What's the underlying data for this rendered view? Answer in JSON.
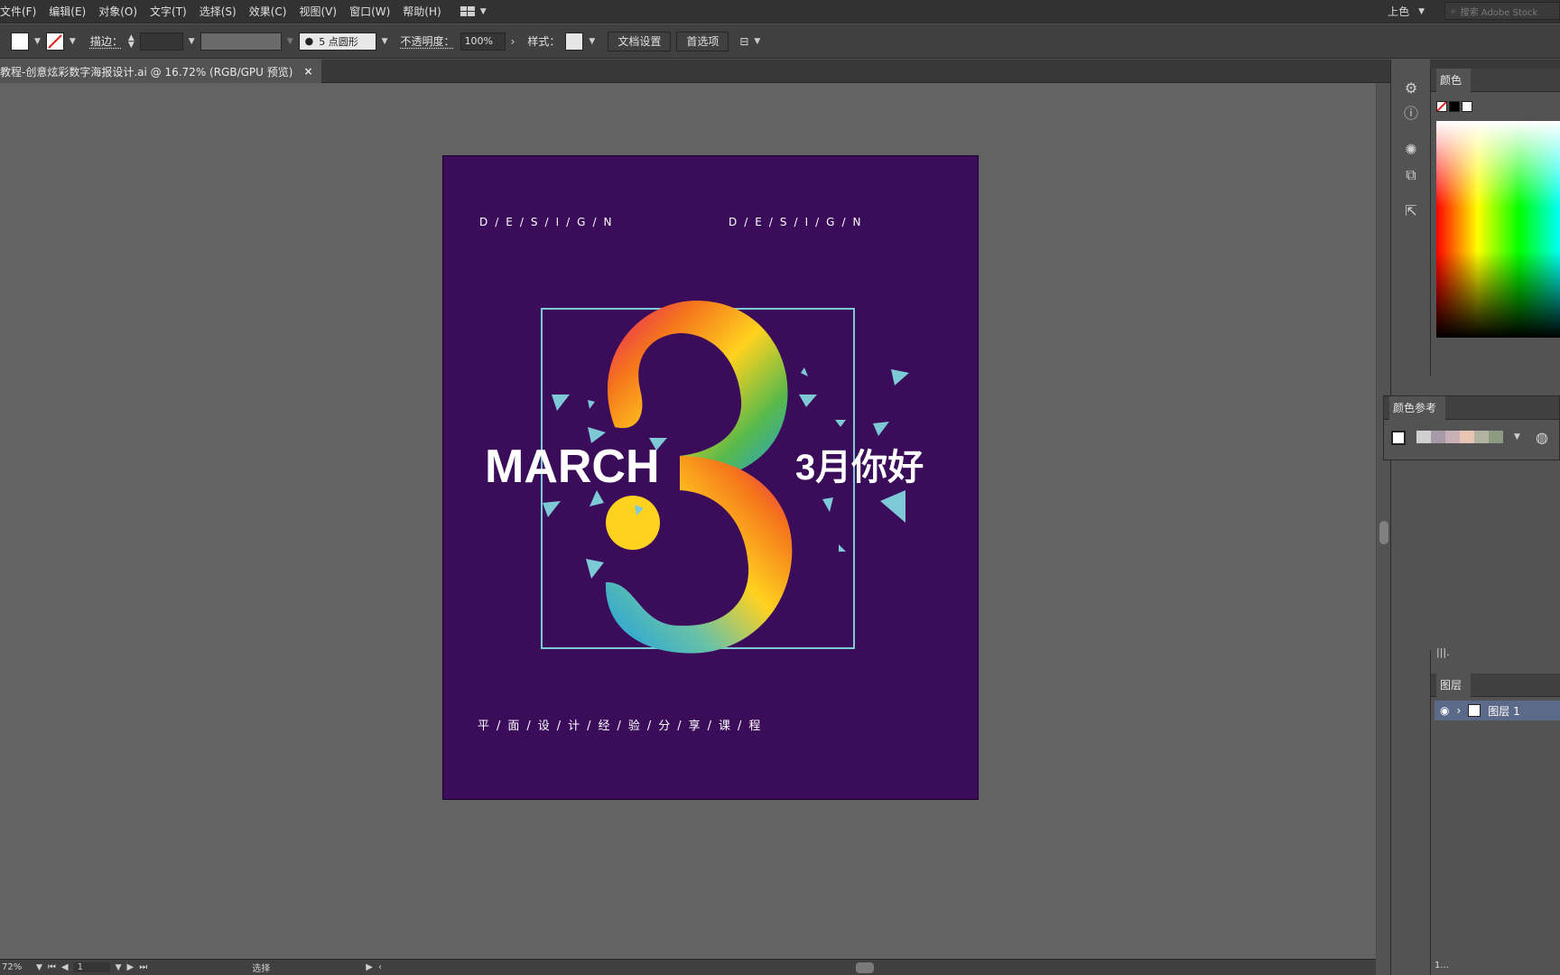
{
  "menu": [
    "文件(F)",
    "编辑(E)",
    "对象(O)",
    "文字(T)",
    "选择(S)",
    "效果(C)",
    "视图(V)",
    "窗口(W)",
    "帮助(H)"
  ],
  "workspace": {
    "name": "上色",
    "search_placeholder": "搜索 Adobe Stock"
  },
  "control": {
    "stroke_label": "描边：",
    "brush": "5 点圆形",
    "opacity_label": "不透明度：",
    "opacity_value": "100%",
    "style_label": "样式：",
    "doc_setup": "文档设置",
    "preferences": "首选项"
  },
  "document": {
    "tab_title": "教程-创意炫彩数字海报设计.ai @ 16.72% (RGB/GPU 预览)",
    "close": "×"
  },
  "poster": {
    "design_left": "D/E/S/I/G/N",
    "design_right": "D/E/S/I/G/N",
    "march": "MARCH",
    "hello": "3月你好",
    "subtitle": "平/面/设/计/经/验/分/享/课/程",
    "bg_color": "#3a0c5a",
    "accent": "#7ec9d6"
  },
  "status": {
    "zoom": "72%",
    "page": "1",
    "tool": "选择"
  },
  "panels": {
    "color_title": "颜色",
    "color_guide_title": "颜色参考",
    "layers_title": "图层",
    "layer_name": "图层 1",
    "layers_count": "1..."
  }
}
